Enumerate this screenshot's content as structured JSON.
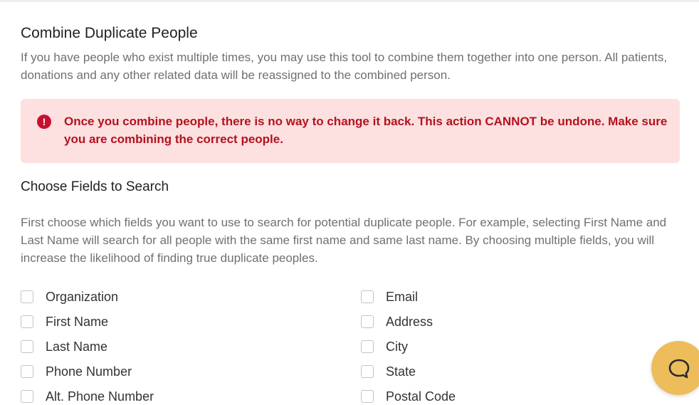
{
  "page": {
    "title": "Combine Duplicate People",
    "intro": "If you have people who exist multiple times, you may use this tool to combine them together into one person. All patients, donations and any other related data will be reassigned to the combined person."
  },
  "alert": {
    "icon": "exclamation-circle-icon",
    "text": "Once you combine people, there is no way to change it back. This action CANNOT be undone. Make sure you are combining the correct people."
  },
  "fields_section": {
    "title": "Choose Fields to Search",
    "description": "First choose which fields you want to use to search for potential duplicate people. For example, selecting First Name and Last Name will search for all people with the same first name and same last name. By choosing multiple fields, you will increase the likelihood of finding true duplicate peoples.",
    "left_fields": [
      "Organization",
      "First Name",
      "Last Name",
      "Phone Number",
      "Alt. Phone Number"
    ],
    "right_fields": [
      "Email",
      "Address",
      "City",
      "State",
      "Postal Code"
    ]
  },
  "chat": {
    "icon": "chat-bubble-icon"
  },
  "colors": {
    "alert_bg": "#fde0e0",
    "alert_text": "#b3121f",
    "chat_button": "#ecbd5a"
  }
}
